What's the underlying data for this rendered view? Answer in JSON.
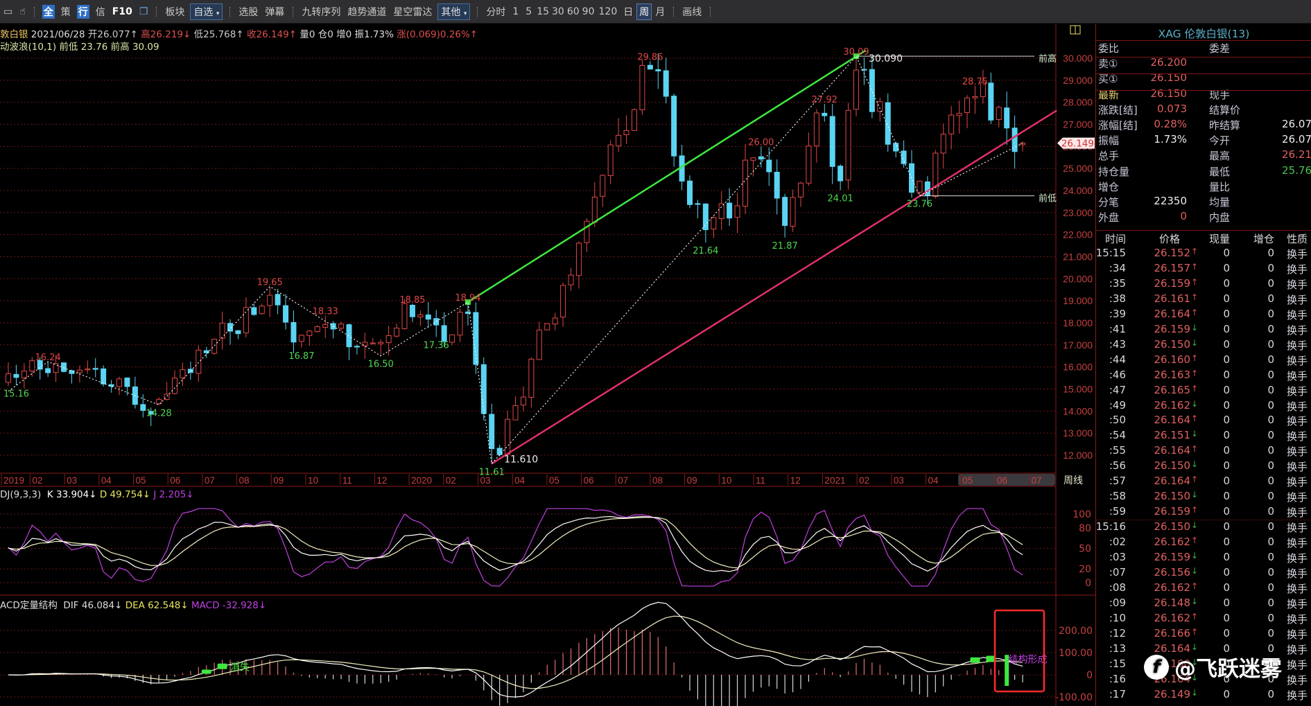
{
  "toolbar": {
    "items": [
      "板块",
      "选股",
      "弹幕",
      "九转序列",
      "趋势通道",
      "星空雷达",
      "分时",
      "1",
      "5",
      "15",
      "30",
      "60",
      "90",
      "120",
      "日",
      "周",
      "月",
      "画线"
    ],
    "quick": [
      "全",
      "策",
      "行",
      "信",
      "F10"
    ],
    "dropdown_zixuan": "自选",
    "dropdown_other": "其他",
    "selected_period": "周"
  },
  "info": {
    "name": "敦白银",
    "date": "2021/06/28",
    "open": "开26.077↑",
    "high": "高26.219↓",
    "low": "低25.768↑",
    "close": "收26.149↑",
    "vol": "量0",
    "oi": "仓0",
    "inc": "增0",
    "amp": "振1.73%",
    "chg": "涨(0.069)0.26%↑",
    "indicator": "动波浪(10,1)",
    "prev_low_label": "前低",
    "prev_low": "23.76",
    "prev_high_label": "前高",
    "prev_high": "30.09"
  },
  "kdj_header": {
    "name": "DJ(9,3,3)",
    "k": "K 33.904↓",
    "d": "D 49.754↓",
    "j": "J 2.205↓"
  },
  "macd_header": {
    "name": "ACD定量结构",
    "dif": "DIF 46.084↓",
    "dea": "DEA 62.548↓",
    "macd": "MACD -32.928↓"
  },
  "colors": {
    "up": "#e04848",
    "down": "#5ad4f2",
    "grid": "#6a1818",
    "axis": "#c84040",
    "green_line": "#3ee83e",
    "pink_line": "#e0306a",
    "purple": "#c040e0"
  },
  "chart_data": [
    {
      "type": "candlestick",
      "title": "XAG 伦敦白银 周线",
      "weeks": 129,
      "last_candle": {
        "open": 26.077,
        "high": 26.219,
        "low": 25.768,
        "close": 26.149
      },
      "price_ticks": [
        "12.000",
        "13.000",
        "14.000",
        "15.000",
        "16.000",
        "17.000",
        "18.000",
        "19.000",
        "20.000",
        "21.000",
        "22.000",
        "23.000",
        "24.000",
        "25.000",
        "26.000",
        "27.000",
        "28.000",
        "29.000",
        "30.000"
      ],
      "current_price": "26.149",
      "pivots": [
        {
          "w": 1,
          "p": 15.16,
          "t": "l",
          "label": "15.16",
          "zig": true
        },
        {
          "w": 5,
          "p": 16.24,
          "t": "h",
          "label": "16.24",
          "zig": true
        },
        {
          "w": 19,
          "p": 14.28,
          "t": "l",
          "label": "14.28",
          "zig": true
        },
        {
          "w": 33,
          "p": 19.65,
          "t": "h",
          "label": "19.65",
          "zig": true
        },
        {
          "w": 37,
          "p": 16.87,
          "t": "l",
          "label": "16.87",
          "zig": false
        },
        {
          "w": 40,
          "p": 18.33,
          "t": "h",
          "label": "18.33",
          "zig": false
        },
        {
          "w": 47,
          "p": 16.5,
          "t": "l",
          "label": "16.50",
          "zig": true
        },
        {
          "w": 51,
          "p": 18.85,
          "t": "h",
          "label": "18.85",
          "zig": false
        },
        {
          "w": 54,
          "p": 17.36,
          "t": "l",
          "label": "17.36",
          "zig": false
        },
        {
          "w": 58,
          "p": 18.94,
          "t": "h",
          "label": "18.94",
          "zig": true
        },
        {
          "w": 61,
          "p": 11.61,
          "t": "l",
          "label": "11.61",
          "zig": true
        },
        {
          "w": 81,
          "p": 29.86,
          "t": "h",
          "label": "29.86",
          "zig": false
        },
        {
          "w": 88,
          "p": 21.64,
          "t": "l",
          "label": "21.64",
          "zig": false
        },
        {
          "w": 95,
          "p": 26.0,
          "t": "h",
          "label": "26.00",
          "zig": false
        },
        {
          "w": 98,
          "p": 21.87,
          "t": "l",
          "label": "21.87",
          "zig": false
        },
        {
          "w": 103,
          "p": 27.92,
          "t": "h",
          "label": "27.92",
          "zig": false
        },
        {
          "w": 105,
          "p": 24.01,
          "t": "l",
          "label": "24.01",
          "zig": false
        },
        {
          "w": 107,
          "p": 30.09,
          "t": "h",
          "label": "30.09",
          "zig": true
        },
        {
          "w": 115,
          "p": 23.76,
          "t": "l",
          "label": "23.76",
          "zig": true
        },
        {
          "w": 122,
          "p": 28.75,
          "t": "h",
          "label": "28.75",
          "zig": false
        }
      ],
      "extreme_labels": [
        {
          "w": 107,
          "p": 30.09,
          "text": "30.090"
        },
        {
          "w": 61,
          "p": 11.61,
          "text": "11.610"
        }
      ],
      "trendlines": [
        {
          "name": "green-channel-line",
          "from": [
            58,
            18.94
          ],
          "to": [
            108.2,
            30.35
          ]
        },
        {
          "name": "pink-channel-line",
          "from": [
            61,
            11.61
          ],
          "to": [
            132.3,
            27.63
          ]
        }
      ],
      "levels": [
        {
          "name": "prev-high",
          "w": 107,
          "p": 30.09,
          "label": "前高"
        },
        {
          "name": "prev-low",
          "w": 115,
          "p": 23.76,
          "label": "前低"
        }
      ],
      "x_labels": [
        {
          "m": 0,
          "t": "2019"
        },
        {
          "m": 1,
          "t": "02"
        },
        {
          "m": 2,
          "t": "03"
        },
        {
          "m": 3,
          "t": "04"
        },
        {
          "m": 4,
          "t": "05"
        },
        {
          "m": 5,
          "t": "06"
        },
        {
          "m": 6,
          "t": "07"
        },
        {
          "m": 7,
          "t": "08"
        },
        {
          "m": 8,
          "t": "09"
        },
        {
          "m": 9,
          "t": "10"
        },
        {
          "m": 10,
          "t": "11"
        },
        {
          "m": 11,
          "t": "12"
        },
        {
          "m": 12,
          "t": "2020"
        },
        {
          "m": 13,
          "t": "02"
        },
        {
          "m": 14,
          "t": "03"
        },
        {
          "m": 15,
          "t": "04"
        },
        {
          "m": 16,
          "t": "05"
        },
        {
          "m": 17,
          "t": "06"
        },
        {
          "m": 18,
          "t": "07"
        },
        {
          "m": 19,
          "t": "08"
        },
        {
          "m": 20,
          "t": "09"
        },
        {
          "m": 21,
          "t": "10"
        },
        {
          "m": 22,
          "t": "11"
        },
        {
          "m": 23,
          "t": "12"
        },
        {
          "m": 24,
          "t": "2021"
        },
        {
          "m": 25,
          "t": "02"
        },
        {
          "m": 26,
          "t": "03"
        },
        {
          "m": 27,
          "t": "04"
        },
        {
          "m": 28,
          "t": "05"
        },
        {
          "m": 29,
          "t": "06"
        },
        {
          "m": 30,
          "t": "07"
        }
      ],
      "period_label": "周线"
    },
    {
      "type": "line",
      "title": "KDJ(9,3,3)",
      "ylim": [
        0,
        100
      ],
      "y_ticks": [
        "100",
        "80",
        "50",
        "20",
        "0"
      ],
      "series": [
        "K",
        "D",
        "J"
      ]
    },
    {
      "type": "bar",
      "title": "MACD定量结构",
      "ylim": [
        -100,
        300
      ],
      "y_ticks": [
        "200.00",
        "100.00",
        "0",
        "-100.00"
      ],
      "series": [
        "DIF",
        "DEA",
        "MACD"
      ],
      "signals": [
        {
          "w": 25,
          "h": 6
        },
        {
          "w": 27,
          "h": 8
        },
        {
          "w": 122,
          "h": 8
        },
        {
          "w": 124,
          "h": 9
        }
      ],
      "big_signal": {
        "w": 126,
        "top": 90,
        "bottom": -50
      },
      "annotations": [
        {
          "w": 28,
          "v": 20,
          "text": "消失",
          "color": "#3ee83e"
        },
        {
          "w": 126.2,
          "v": 55,
          "text": "结构形成",
          "color": "#c040e0"
        }
      ]
    }
  ],
  "quote": {
    "title": "XAG 伦敦白银(13)",
    "rows": [
      {
        "l": "委比",
        "v": "",
        "l2": "委差",
        "v2": "",
        "c": "#fff",
        "c2": "#fff"
      },
      {
        "l": "卖①",
        "v": "26.200",
        "l2": "",
        "v2": "",
        "c": "#e06060",
        "c2": "#fff"
      },
      {
        "l": "买①",
        "v": "26.150",
        "l2": "",
        "v2": "",
        "c": "#e06060",
        "c2": "#fff"
      },
      {
        "l": "最新",
        "v": "26.150",
        "l2": "现手",
        "v2": "",
        "c": "#e06060",
        "c2": "#fff"
      },
      {
        "l": "涨跌[结]",
        "v": "0.073",
        "l2": "结算价",
        "v2": "",
        "c": "#e06060",
        "c2": "#fff"
      },
      {
        "l": "涨幅[结]",
        "v": "0.28%",
        "l2": "昨结算",
        "v2": "26.07",
        "c": "#e06060",
        "c2": "#eee"
      },
      {
        "l": "振幅",
        "v": "1.73%",
        "l2": "今开",
        "v2": "26.07",
        "c": "#eee",
        "c2": "#eee"
      },
      {
        "l": "总手",
        "v": "",
        "l2": "最高",
        "v2": "26.21",
        "c": "#eee",
        "c2": "#e06060"
      },
      {
        "l": "持仓量",
        "v": "",
        "l2": "最低",
        "v2": "25.76",
        "c": "#eee",
        "c2": "#4ec24e"
      },
      {
        "l": "增仓",
        "v": "",
        "l2": "量比",
        "v2": "",
        "c": "#eee",
        "c2": "#eee"
      },
      {
        "l": "分笔",
        "v": "22350",
        "l2": "均量",
        "v2": "",
        "c": "#eee",
        "c2": "#eee"
      },
      {
        "l": "外盘",
        "v": "0",
        "l2": "内盘",
        "v2": "",
        "c": "#e06060",
        "c2": "#eee"
      }
    ]
  },
  "trades": {
    "headers": [
      "时间",
      "价格",
      "现量",
      "增仓",
      "性质"
    ],
    "rows": [
      [
        "15:15",
        "26.152",
        "↑"
      ],
      [
        ":34",
        "26.157",
        "↑"
      ],
      [
        ":35",
        "26.159",
        "↑"
      ],
      [
        ":38",
        "26.161",
        "↑"
      ],
      [
        ":39",
        "26.164",
        "↑"
      ],
      [
        ":41",
        "26.159",
        "↓"
      ],
      [
        ":43",
        "26.150",
        "↓"
      ],
      [
        ":44",
        "26.160",
        "↑"
      ],
      [
        ":46",
        "26.163",
        "↑"
      ],
      [
        ":47",
        "26.165",
        "↑"
      ],
      [
        ":49",
        "26.162",
        "↓"
      ],
      [
        ":50",
        "26.164",
        "↑"
      ],
      [
        ":54",
        "26.151",
        "↓"
      ],
      [
        ":55",
        "26.164",
        "↑"
      ],
      [
        ":56",
        "26.150",
        "↓"
      ],
      [
        ":57",
        "26.164",
        "↑"
      ],
      [
        ":58",
        "26.150",
        "↓"
      ],
      [
        ":59",
        "26.159",
        "↑"
      ],
      [
        "15:16",
        "26.150",
        "↓"
      ],
      [
        ":02",
        "26.162",
        "↑"
      ],
      [
        ":03",
        "26.159",
        "↓"
      ],
      [
        ":07",
        "26.156",
        "↓"
      ],
      [
        ":08",
        "26.162",
        "↑"
      ],
      [
        ":09",
        "26.148",
        "↓"
      ],
      [
        ":10",
        "26.162",
        "↑"
      ],
      [
        ":12",
        "26.166",
        "↑"
      ],
      [
        ":13",
        "26.164",
        "↓"
      ],
      [
        ":15",
        "26.160",
        "↓"
      ],
      [
        ":16",
        "26.164",
        "↓"
      ],
      [
        ":17",
        "26.149",
        "↓"
      ]
    ],
    "vol": "0",
    "oi": "0",
    "kind": "换手"
  },
  "watermark": "@飞跃迷雾"
}
